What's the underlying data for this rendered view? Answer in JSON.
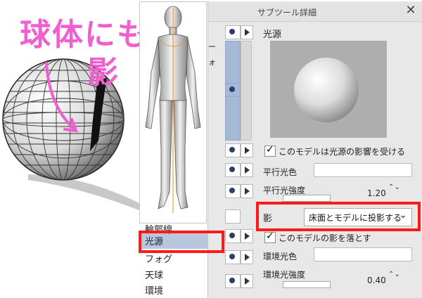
{
  "annotation": {
    "line1": "球体にも",
    "line2": "影"
  },
  "panel": {
    "title": "サブツール詳細",
    "close_glyph": "✕",
    "section_title": "光源",
    "light_influence_label": "このモデルは光源の影響を受ける",
    "directional_color_label": "平行光色",
    "directional_intensity_label": "平行光強度",
    "directional_intensity_value": "1.20",
    "shadow_label": "影",
    "shadow_select_value": "床面とモデルに投影する",
    "cast_shadow_label": "このモデルの影を落とす",
    "ambient_color_label": "環境光色",
    "ambient_intensity_label": "環境光強度",
    "ambient_intensity_value": "0.40",
    "partial_text_1": "ー",
    "partial_text_2": "ォ",
    "spin_glyph": "⌃⌄"
  },
  "categories": {
    "items": [
      "輪郭線",
      "光源",
      "フォグ",
      "天球",
      "環境"
    ],
    "selected": "光源"
  },
  "colors": {
    "annotation": "#f05fd0",
    "highlight_red": "#ff1a1a",
    "selected_row": "#b7c7de",
    "bluebar": "#a4b9d6"
  }
}
